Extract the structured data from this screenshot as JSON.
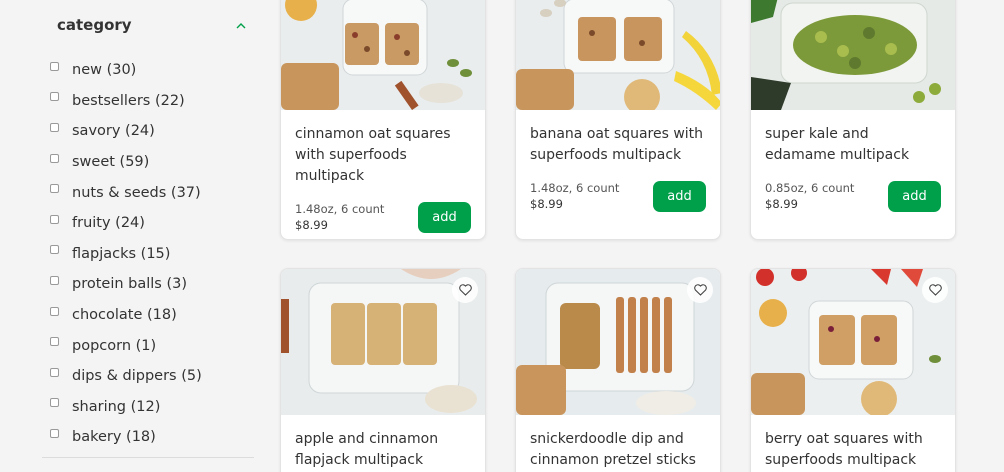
{
  "sidebar": {
    "title": "category",
    "items": [
      {
        "label": "new (30)"
      },
      {
        "label": "bestsellers (22)"
      },
      {
        "label": "savory (24)"
      },
      {
        "label": "sweet (59)"
      },
      {
        "label": "nuts & seeds (37)"
      },
      {
        "label": "fruity (24)"
      },
      {
        "label": "flapjacks (15)"
      },
      {
        "label": "protein balls (3)"
      },
      {
        "label": "chocolate (18)"
      },
      {
        "label": "popcorn (1)"
      },
      {
        "label": "dips & dippers (5)"
      },
      {
        "label": "sharing (12)"
      },
      {
        "label": "bakery (18)"
      }
    ]
  },
  "products": [
    {
      "name": "cinnamon oat squares with superfoods multipack",
      "size": "1.48oz, 6 count",
      "price": "$8.99",
      "add": "add"
    },
    {
      "name": "banana oat squares with superfoods multipack",
      "size": "1.48oz, 6 count",
      "price": "$8.99",
      "add": "add"
    },
    {
      "name": "super kale and edamame multipack",
      "size": "0.85oz, 6 count",
      "price": "$8.99",
      "add": "add"
    },
    {
      "name": "apple and cinnamon flapjack multipack"
    },
    {
      "name": "snickerdoodle dip and cinnamon pretzel sticks"
    },
    {
      "name": "berry oat squares with superfoods multipack"
    }
  ],
  "icons": {
    "chevron": "chevron-up-icon",
    "heart": "heart-outline-icon"
  },
  "colors": {
    "accent": "#00a04b"
  }
}
